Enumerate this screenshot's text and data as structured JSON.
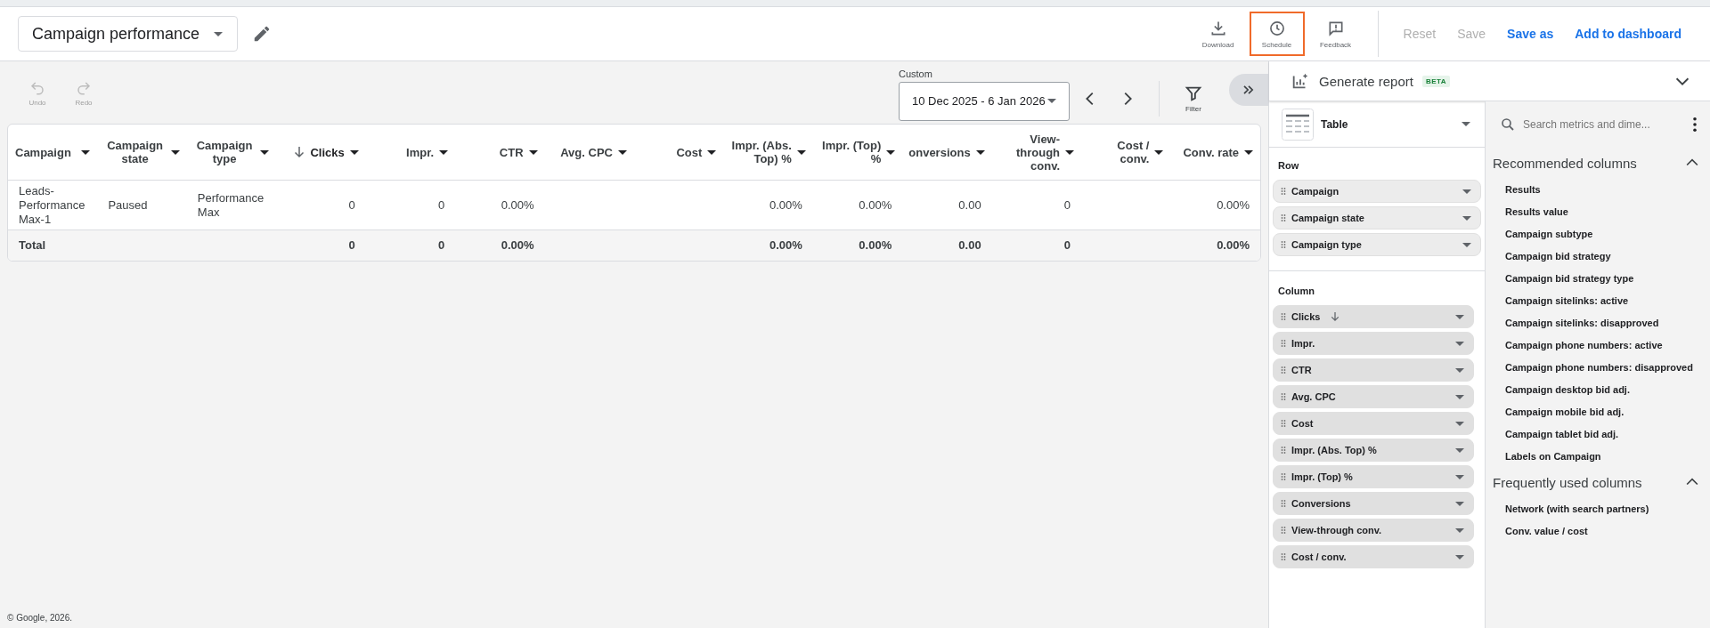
{
  "header": {
    "report_name": "Campaign performance",
    "actions": [
      {
        "label": "Download",
        "kind": "download",
        "selected": false
      },
      {
        "label": "Schedule",
        "kind": "schedule",
        "selected": true
      },
      {
        "label": "Feedback",
        "kind": "feedback",
        "selected": false
      }
    ],
    "buttons": [
      {
        "label": "Reset",
        "disabled": true
      },
      {
        "label": "Save",
        "disabled": true
      },
      {
        "label": "Save as",
        "disabled": false
      },
      {
        "label": "Add to dashboard",
        "disabled": false
      }
    ]
  },
  "toolbar": {
    "undo": "Undo",
    "redo": "Redo",
    "date_label": "Custom",
    "date_range": "10 Dec 2025 - 6 Jan 2026",
    "filter": "Filter"
  },
  "table": {
    "columns": [
      {
        "label": "Campaign",
        "kind": "dimension",
        "sorted": false
      },
      {
        "label": "Campaign state",
        "kind": "dimension",
        "sorted": false
      },
      {
        "label": "Campaign type",
        "kind": "dimension",
        "sorted": false
      },
      {
        "label": "Clicks",
        "kind": "metric",
        "sorted": true,
        "total": "0"
      },
      {
        "label": "Impr.",
        "kind": "metric",
        "sorted": false,
        "total": "0"
      },
      {
        "label": "CTR",
        "kind": "metric",
        "sorted": false,
        "total": "0.00%"
      },
      {
        "label": "Avg. CPC",
        "kind": "metric",
        "sorted": false
      },
      {
        "label": "Cost",
        "kind": "metric",
        "sorted": false
      },
      {
        "label": "Impr. (Abs. Top) %",
        "kind": "metric",
        "sorted": false,
        "total": "0.00%"
      },
      {
        "label": "Impr. (Top) %",
        "kind": "metric",
        "sorted": false,
        "total": "0.00%"
      },
      {
        "label": "onversions",
        "kind": "metric",
        "sorted": false,
        "total": "0.00"
      },
      {
        "label": "View-through conv.",
        "kind": "metric",
        "sorted": false,
        "total": "0"
      },
      {
        "label": "Cost / conv.",
        "kind": "metric",
        "sorted": false
      },
      {
        "label": "Conv. rate",
        "kind": "metric",
        "sorted": false,
        "total": "0.00%"
      }
    ],
    "rows": [
      [
        "Leads-Performance Max-1",
        "Paused",
        "Performance Max",
        "0",
        "0",
        "0.00%",
        null,
        null,
        "0.00%",
        "0.00%",
        "0.00",
        "0",
        null,
        "0.00%"
      ]
    ],
    "total_label": "Total"
  },
  "panel": {
    "title": "Generate report",
    "badge": "BETA",
    "visualization": "Table",
    "row_label": "Row",
    "row_chips": [
      {
        "label": "Campaign",
        "sorted": false
      },
      {
        "label": "Campaign state",
        "sorted": false
      },
      {
        "label": "Campaign type",
        "sorted": false
      }
    ],
    "column_label": "Column",
    "column_chips": [
      {
        "label": "Clicks",
        "sorted": true
      },
      {
        "label": "Impr.",
        "sorted": false
      },
      {
        "label": "CTR",
        "sorted": false
      },
      {
        "label": "Avg. CPC",
        "sorted": false
      },
      {
        "label": "Cost",
        "sorted": false
      },
      {
        "label": "Impr. (Abs. Top) %",
        "sorted": false
      },
      {
        "label": "Impr. (Top) %",
        "sorted": false
      },
      {
        "label": "Conversions",
        "sorted": false
      },
      {
        "label": "View-through conv.",
        "sorted": false
      },
      {
        "label": "Cost / conv.",
        "sorted": false
      }
    ],
    "search": {
      "placeholder": "Search metrics and dime..."
    },
    "sections": [
      {
        "title": "Recommended columns",
        "expanded": true,
        "items": [
          "Results",
          "Results value",
          "Campaign subtype",
          "Campaign bid strategy",
          "Campaign bid strategy type",
          "Campaign sitelinks: active",
          "Campaign sitelinks: disapproved",
          "Campaign phone numbers: active",
          "Campaign phone numbers: disapproved",
          "Campaign desktop bid adj.",
          "Campaign mobile bid adj.",
          "Campaign tablet bid adj.",
          "Labels on Campaign"
        ]
      },
      {
        "title": "Frequently used columns",
        "expanded": true,
        "items": [
          "Network (with search partners)",
          "Conv. value / cost"
        ]
      }
    ]
  },
  "footer": "© Google, 2026."
}
